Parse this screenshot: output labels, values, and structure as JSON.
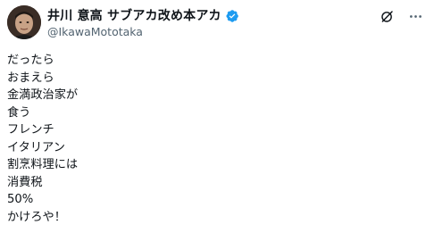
{
  "post": {
    "author": {
      "display_name": "井川 意高 サブアカ改め本アカ",
      "handle": "@IkawaMototaka",
      "verified": true
    },
    "actions": {
      "grok_icon": "grok-icon",
      "more_icon": "more-options-icon"
    },
    "lines": [
      "だったら",
      "おまえら",
      "金満政治家が",
      "食う",
      "フレンチ",
      "イタリアン",
      "割烹料理には",
      "消費税",
      "50%",
      "かけろや！"
    ],
    "colors": {
      "text": "#0f1419",
      "secondary": "#536471",
      "verified": "#1d9bf0"
    }
  }
}
